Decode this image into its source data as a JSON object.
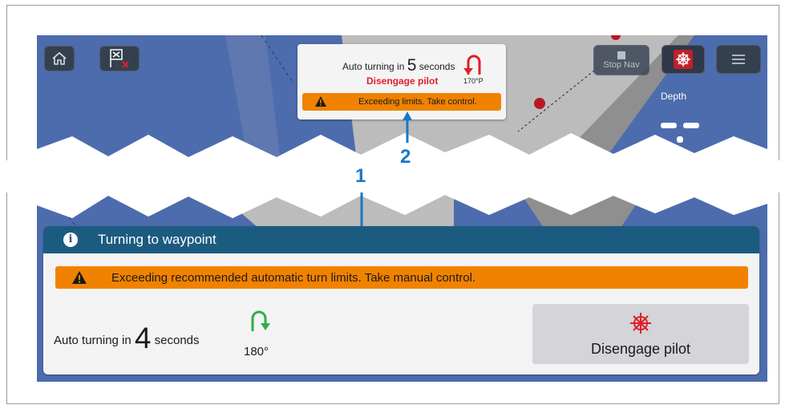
{
  "map_toolbar": {
    "home_icon": "home-icon",
    "waypoint_icon": "waypoint-cancel-icon",
    "stop_nav_label": "Stop Nav",
    "alarm_icon": "pilot-alarm-icon",
    "menu_icon": "hamburger-menu-icon"
  },
  "depth": {
    "label": "Depth"
  },
  "popup": {
    "auto_prefix": "Auto turning in",
    "count": "5",
    "auto_suffix": "seconds",
    "disengage": "Disengage pilot",
    "heading": "170°P",
    "warning": "Exceeding limits. Take control.",
    "turn_icon": "u-turn-port-icon"
  },
  "callouts": {
    "one": "1",
    "two": "2"
  },
  "dialog": {
    "title": "Turning to waypoint",
    "info_icon": "i",
    "warning": "Exceeding recommended automatic turn limits.   Take manual control.",
    "auto_prefix": "Auto turning in",
    "count": "4",
    "auto_suffix": "seconds",
    "heading": "180°",
    "turn_icon": "u-turn-starboard-icon",
    "disengage_label": "Disengage pilot"
  },
  "colors": {
    "warning_orange": "#f18200",
    "header_blue": "#1c5b80",
    "alert_red": "#e0202a",
    "turn_green": "#2eae4a",
    "callout_blue": "#1978c8"
  }
}
